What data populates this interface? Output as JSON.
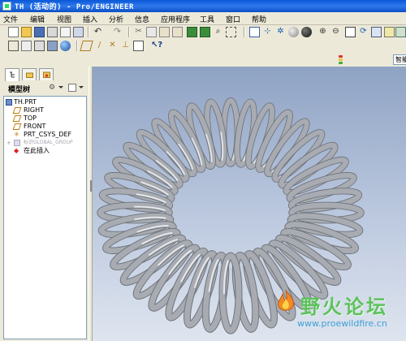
{
  "window": {
    "title": "TH (活动的) - Pro/ENGINEER"
  },
  "menu": {
    "items": [
      {
        "key": "file",
        "label": "文件"
      },
      {
        "key": "edit",
        "label": "编辑"
      },
      {
        "key": "view",
        "label": "视图"
      },
      {
        "key": "insert",
        "label": "插入"
      },
      {
        "key": "analysis",
        "label": "分析"
      },
      {
        "key": "info",
        "label": "信息"
      },
      {
        "key": "applications",
        "label": "应用程序"
      },
      {
        "key": "tools",
        "label": "工具"
      },
      {
        "key": "window",
        "label": "窗口"
      },
      {
        "key": "help",
        "label": "帮助"
      }
    ]
  },
  "toolbar": {
    "row1_icons": [
      "new-icon",
      "open-icon",
      "save-icon",
      "print-icon",
      "email-icon",
      "copy-file-icon",
      "undo-icon",
      "redo-icon",
      "cut-icon",
      "copy-icon",
      "paste-icon",
      "paste-special-icon",
      "regenerate-icon",
      "regen-manager-icon",
      "find-icon",
      "select-box-icon",
      "repaint-icon",
      "spin-center-icon",
      "orient-icon",
      "shade-icon",
      "display-style-icon",
      "zoom-in-icon",
      "zoom-out-icon",
      "refit-icon",
      "reorient-icon",
      "saved-views-icon",
      "layers-icon",
      "view-manager-icon"
    ],
    "row2_icons": [
      "wireframe-icon",
      "hidden-line-icon",
      "no-hidden-icon",
      "shading-icon",
      "enhanced-realism-icon",
      "plane-display-icon",
      "axis-display-icon",
      "point-display-icon",
      "csys-display-icon",
      "annotation-display-icon",
      "context-help-icon"
    ]
  },
  "status": {
    "smart_filter": "智能"
  },
  "model_tree": {
    "tabs": [
      "model-tree-tab",
      "folder-browser-tab",
      "favorites-tab"
    ],
    "header": "模型树",
    "items": [
      {
        "label": "TH.PRT",
        "icon": "part-icon",
        "indent": 0
      },
      {
        "label": "RIGHT",
        "icon": "datum-plane-icon",
        "indent": 1
      },
      {
        "label": "TOP",
        "icon": "datum-plane-icon",
        "indent": 1
      },
      {
        "label": "FRONT",
        "icon": "datum-plane-icon",
        "indent": 1
      },
      {
        "label": "PRT_CSYS_DEF",
        "icon": "csys-icon",
        "indent": 1
      },
      {
        "label": "标识GLOBAL_GROUP",
        "icon": "group-icon",
        "indent": 1
      },
      {
        "label": "在此插入",
        "icon": "insert-here-icon",
        "indent": 1
      }
    ]
  },
  "colors": {
    "titlebar": "#0a58d8",
    "viewport_top": "#8fa3c4",
    "viewport_bottom": "#dfe5ef",
    "spring": "#a8acb2",
    "watermark_text": "#5ec25e",
    "watermark_url": "#3f9fd6"
  },
  "viewport": {
    "model": "torus-coil-spring",
    "watermark": {
      "text": "野火论坛",
      "url": "www.proewildfire.cn"
    }
  }
}
